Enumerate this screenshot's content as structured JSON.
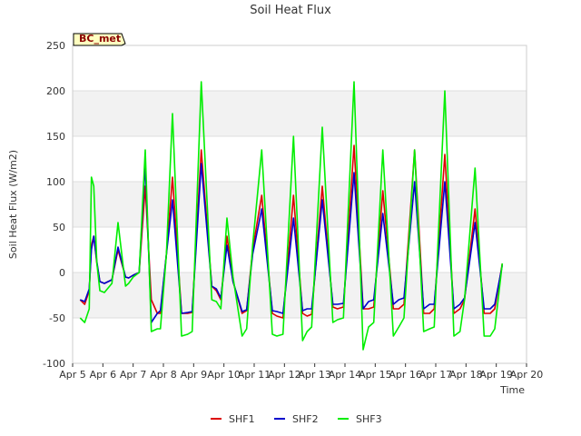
{
  "chart_data": {
    "type": "line",
    "title": "Soil Heat Flux",
    "xlabel": "Time",
    "ylabel": "Soil Heat Flux (W/m2)",
    "ylim": [
      -100,
      250
    ],
    "yticks": [
      -100,
      -50,
      0,
      50,
      100,
      150,
      200,
      250
    ],
    "x_ticks": [
      "Apr 5",
      "Apr 6",
      "Apr 7",
      "Apr 8",
      "Apr 9",
      "Apr 10",
      "Apr 11",
      "Apr 12",
      "Apr 13",
      "Apr 14",
      "Apr 15",
      "Apr 16",
      "Apr 17",
      "Apr 18",
      "Apr 19",
      "Apr 20"
    ],
    "grid": true,
    "background_bands": true,
    "legend_position": "bottom-center",
    "annotation": "BC_met",
    "colors": {
      "SHF1": "#dd0000",
      "SHF2": "#0000cc",
      "SHF3": "#00ee00"
    },
    "series": [
      {
        "name": "SHF1",
        "x": [
          5.25,
          5.4,
          5.55,
          5.62,
          5.7,
          5.8,
          5.9,
          6.05,
          6.3,
          6.5,
          6.75,
          6.85,
          7.0,
          7.2,
          7.4,
          7.6,
          7.8,
          7.9,
          8.1,
          8.3,
          8.6,
          8.8,
          8.95,
          9.25,
          9.6,
          9.75,
          9.9,
          10.1,
          10.3,
          10.6,
          10.75,
          10.95,
          11.25,
          11.6,
          11.75,
          11.95,
          12.3,
          12.6,
          12.75,
          12.9,
          13.25,
          13.6,
          13.75,
          13.95,
          14.3,
          14.6,
          14.78,
          14.95,
          15.25,
          15.6,
          15.78,
          15.95,
          16.3,
          16.6,
          16.8,
          16.95,
          17.3,
          17.6,
          17.8,
          17.95,
          18.3,
          18.6,
          18.8,
          18.95,
          19.2
        ],
        "y": [
          -30,
          -35,
          -20,
          30,
          40,
          10,
          -10,
          -12,
          -8,
          25,
          -5,
          -6,
          -3,
          0,
          95,
          -30,
          -45,
          -45,
          20,
          105,
          -45,
          -45,
          -44,
          135,
          -15,
          -20,
          -30,
          40,
          -10,
          -45,
          -42,
          25,
          85,
          -45,
          -48,
          -50,
          85,
          -45,
          -48,
          -46,
          95,
          -38,
          -40,
          -38,
          140,
          -40,
          -40,
          -38,
          90,
          -40,
          -40,
          -35,
          135,
          -45,
          -45,
          -40,
          130,
          -45,
          -40,
          -30,
          70,
          -45,
          -45,
          -40,
          10
        ]
      },
      {
        "name": "SHF2",
        "x": [
          5.25,
          5.4,
          5.55,
          5.62,
          5.7,
          5.8,
          5.9,
          6.05,
          6.3,
          6.5,
          6.75,
          6.85,
          7.0,
          7.2,
          7.4,
          7.6,
          7.8,
          7.9,
          8.1,
          8.3,
          8.6,
          8.8,
          8.95,
          9.25,
          9.6,
          9.75,
          9.9,
          10.1,
          10.3,
          10.6,
          10.75,
          10.95,
          11.25,
          11.6,
          11.75,
          11.95,
          12.3,
          12.6,
          12.75,
          12.9,
          13.25,
          13.6,
          13.75,
          13.95,
          14.3,
          14.6,
          14.78,
          14.95,
          15.25,
          15.6,
          15.78,
          15.95,
          16.3,
          16.6,
          16.8,
          16.95,
          17.3,
          17.6,
          17.8,
          17.95,
          18.3,
          18.6,
          18.8,
          18.95,
          19.2
        ],
        "y": [
          -30,
          -32,
          -18,
          25,
          40,
          12,
          -10,
          -12,
          -8,
          28,
          -5,
          -6,
          -3,
          0,
          120,
          -55,
          -45,
          -42,
          20,
          80,
          -45,
          -44,
          -43,
          120,
          -15,
          -18,
          -28,
          30,
          -10,
          -43,
          -41,
          20,
          70,
          -42,
          -43,
          -45,
          60,
          -42,
          -40,
          -40,
          80,
          -35,
          -35,
          -34,
          110,
          -40,
          -32,
          -30,
          65,
          -35,
          -30,
          -28,
          100,
          -40,
          -35,
          -35,
          100,
          -40,
          -35,
          -28,
          55,
          -40,
          -40,
          -35,
          8
        ]
      },
      {
        "name": "SHF3",
        "x": [
          5.25,
          5.4,
          5.55,
          5.62,
          5.7,
          5.8,
          5.9,
          6.05,
          6.3,
          6.5,
          6.75,
          6.85,
          7.0,
          7.2,
          7.4,
          7.6,
          7.8,
          7.9,
          8.1,
          8.3,
          8.6,
          8.8,
          8.95,
          9.25,
          9.6,
          9.75,
          9.9,
          10.1,
          10.3,
          10.6,
          10.75,
          10.95,
          11.25,
          11.6,
          11.75,
          11.95,
          12.3,
          12.6,
          12.75,
          12.9,
          13.25,
          13.6,
          13.75,
          13.95,
          14.3,
          14.6,
          14.78,
          14.95,
          15.25,
          15.6,
          15.78,
          15.95,
          16.3,
          16.6,
          16.8,
          16.95,
          17.3,
          17.6,
          17.8,
          17.95,
          18.3,
          18.6,
          18.8,
          18.95,
          19.2
        ],
        "y": [
          -50,
          -55,
          -40,
          105,
          95,
          10,
          -20,
          -22,
          -12,
          55,
          -15,
          -12,
          -5,
          0,
          135,
          -65,
          -62,
          -62,
          20,
          175,
          -70,
          -68,
          -65,
          210,
          -30,
          -32,
          -40,
          60,
          -5,
          -70,
          -62,
          30,
          135,
          -68,
          -70,
          -68,
          150,
          -75,
          -65,
          -60,
          160,
          -55,
          -52,
          -50,
          210,
          -85,
          -60,
          -55,
          135,
          -70,
          -60,
          -50,
          135,
          -65,
          -62,
          -60,
          200,
          -70,
          -65,
          -30,
          115,
          -70,
          -70,
          -62,
          10
        ]
      }
    ]
  }
}
